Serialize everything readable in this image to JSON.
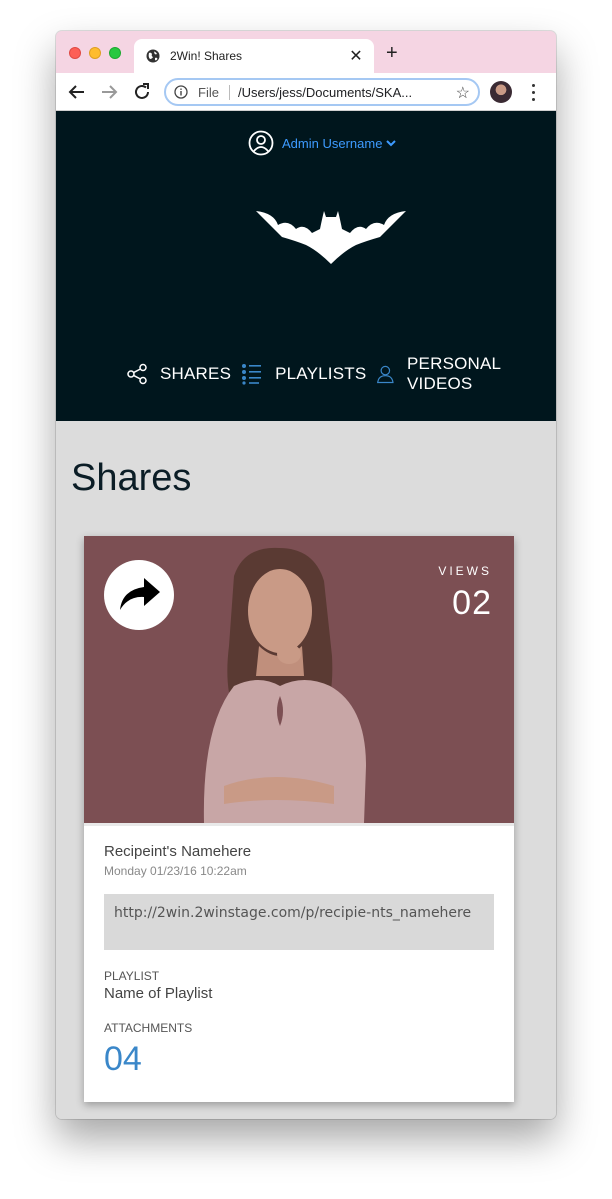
{
  "browser": {
    "tab_title": "2Win! Shares",
    "tab_close": "✕",
    "new_tab": "+",
    "omnibox_scheme": "File",
    "url": "/Users/jess/Documents/SKA..."
  },
  "header": {
    "user_name": "Admin Username",
    "nav": [
      {
        "label": "SHARES",
        "icon": "share-icon"
      },
      {
        "label": "PLAYLISTS",
        "icon": "list-icon"
      },
      {
        "label": "PERSONAL VIDEOS",
        "icon": "person-icon"
      }
    ]
  },
  "page": {
    "title": "Shares"
  },
  "share_card": {
    "views_label": "VIEWS",
    "views_count": "02",
    "recipient": "Recipeint's Namehere",
    "date": "Monday 01/23/16 10:22am",
    "link": "http://2win.2winstage.com/p/recipie-nts_namehere",
    "playlist_label": "PLAYLIST",
    "playlist_name": "Name of Playlist",
    "attachments_label": "ATTACHMENTS",
    "attachments_count": "04"
  },
  "colors": {
    "header_bg": "#00161d",
    "accent_blue": "#3d9bff",
    "attachments_blue": "#3a87c9",
    "tab_strip": "#f5d5e3"
  }
}
